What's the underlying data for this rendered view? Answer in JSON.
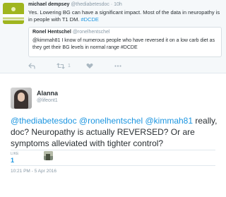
{
  "reply_tweet": {
    "author_name": "michael dempsey",
    "author_meta": "@thediabetesdoc · 10h",
    "text_main": "Yes. Lowering BG can have a significant impact. Most of the data in neuropathy is in people with T1 DM. ",
    "hashtag": "#DCDE",
    "quote": {
      "name": "Ronel Hentschel",
      "handle": "@ronelhentschel",
      "text": "@kimmah81 I know of numerous people who have reversed it on a low carb diet as they get their BG levels in normal range #DCDE"
    },
    "retweet_count": "1",
    "icons": [
      "reply-icon",
      "retweet-icon",
      "heart-icon",
      "more-icon"
    ]
  },
  "main_tweet": {
    "author_name": "Alanna",
    "author_handle": "@lifeont1",
    "mentions": "@thediabetesdoc @ronelhentschel @kimmah81",
    "text": " really, doc? Neuropathy is actually REVERSED? Or are symptoms alleviated with tighter control?",
    "likes_label": "LIKE",
    "likes_count": "1",
    "timestamp": "10:21 PM - 5 Apr 2016"
  },
  "colors": {
    "link": "#1b95e0",
    "muted": "#8899a6",
    "text": "#292f33"
  }
}
